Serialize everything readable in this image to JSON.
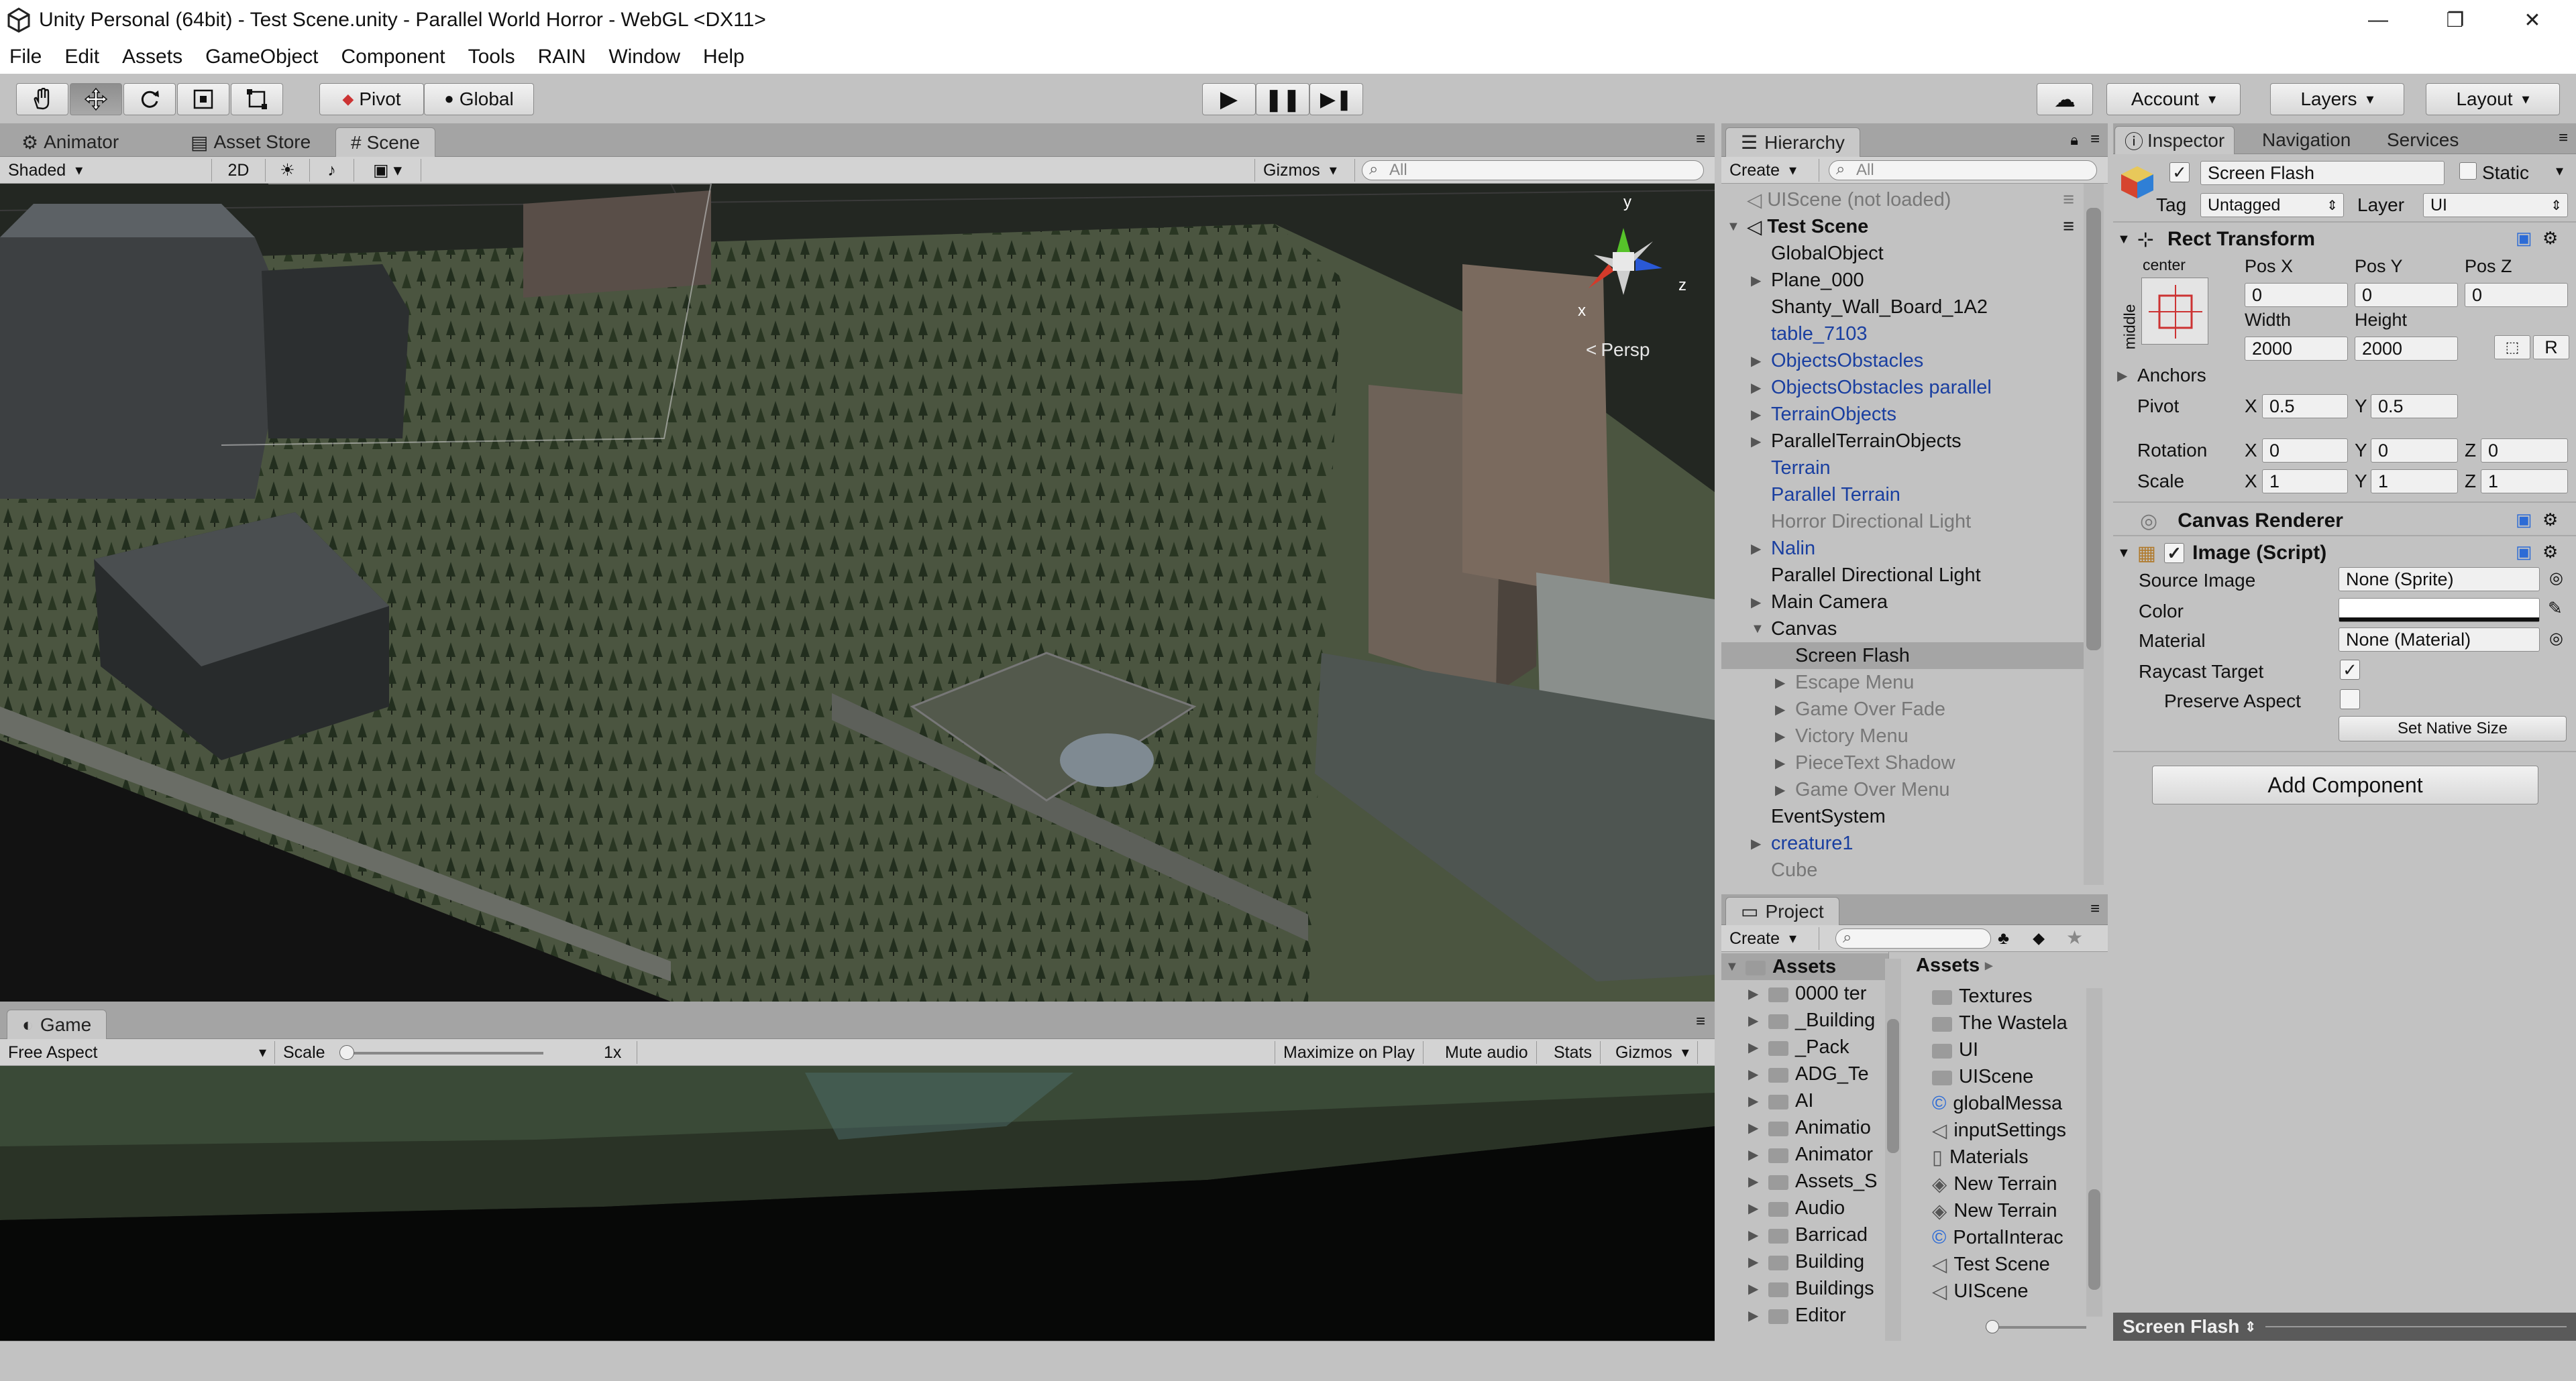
{
  "window": {
    "title": "Unity Personal (64bit) - Test Scene.unity - Parallel World Horror - WebGL <DX11>",
    "controls": [
      "—",
      "❐",
      "✕"
    ]
  },
  "menu": [
    "File",
    "Edit",
    "Assets",
    "GameObject",
    "Component",
    "Tools",
    "RAIN",
    "Window",
    "Help"
  ],
  "toolbar": {
    "pivot": "Pivot",
    "global": "Global",
    "account": "Account",
    "layers": "Layers",
    "layout": "Layout"
  },
  "scene_panel": {
    "tabs": [
      "Animator",
      "Asset Store",
      "Scene"
    ],
    "shading": "Shaded",
    "mode_2d": "2D",
    "gizmos": "Gizmos",
    "search_placeholder": "All",
    "persp": "Persp",
    "axis": {
      "x": "x",
      "y": "y",
      "z": "z"
    }
  },
  "game_panel": {
    "tab": "Game",
    "aspect": "Free Aspect",
    "scale_label": "Scale",
    "scale_value": "1x",
    "scale_fraction": 0.0,
    "buttons": [
      "Maximize on Play",
      "Mute audio",
      "Stats",
      "Gizmos"
    ]
  },
  "hierarchy": {
    "tab": "Hierarchy",
    "create": "Create",
    "search_placeholder": "All",
    "rows": [
      {
        "label": "UIScene (not loaded)",
        "indent": 0,
        "style": "gray",
        "arrow": "",
        "icon": true
      },
      {
        "label": "Test Scene",
        "indent": 0,
        "style": "bold",
        "arrow": "▼",
        "icon": true
      },
      {
        "label": "GlobalObject",
        "indent": 1,
        "style": "",
        "arrow": ""
      },
      {
        "label": "Plane_000",
        "indent": 1,
        "style": "",
        "arrow": "▶"
      },
      {
        "label": "Shanty_Wall_Board_1A2",
        "indent": 1,
        "style": "",
        "arrow": ""
      },
      {
        "label": "table_7103",
        "indent": 1,
        "style": "blue",
        "arrow": ""
      },
      {
        "label": "ObjectsObstacles",
        "indent": 1,
        "style": "blue",
        "arrow": "▶"
      },
      {
        "label": "ObjectsObstacles parallel",
        "indent": 1,
        "style": "blue",
        "arrow": "▶"
      },
      {
        "label": "TerrainObjects",
        "indent": 1,
        "style": "blue",
        "arrow": "▶"
      },
      {
        "label": "ParallelTerrainObjects",
        "indent": 1,
        "style": "",
        "arrow": "▶"
      },
      {
        "label": "Terrain",
        "indent": 1,
        "style": "blue",
        "arrow": ""
      },
      {
        "label": "Parallel Terrain",
        "indent": 1,
        "style": "blue",
        "arrow": ""
      },
      {
        "label": "Horror Directional Light",
        "indent": 1,
        "style": "gray",
        "arrow": ""
      },
      {
        "label": "Nalin",
        "indent": 1,
        "style": "blue",
        "arrow": "▶"
      },
      {
        "label": "Parallel Directional Light",
        "indent": 1,
        "style": "",
        "arrow": ""
      },
      {
        "label": "Main Camera",
        "indent": 1,
        "style": "",
        "arrow": "▶"
      },
      {
        "label": "Canvas",
        "indent": 1,
        "style": "",
        "arrow": "▼"
      },
      {
        "label": "Screen Flash",
        "indent": 2,
        "style": "sel",
        "arrow": ""
      },
      {
        "label": "Escape Menu",
        "indent": 2,
        "style": "gray",
        "arrow": "▶"
      },
      {
        "label": "Game Over Fade",
        "indent": 2,
        "style": "gray",
        "arrow": "▶"
      },
      {
        "label": "Victory Menu",
        "indent": 2,
        "style": "gray",
        "arrow": "▶"
      },
      {
        "label": "PieceText Shadow",
        "indent": 2,
        "style": "gray",
        "arrow": "▶"
      },
      {
        "label": "Game Over Menu",
        "indent": 2,
        "style": "gray",
        "arrow": "▶"
      },
      {
        "label": "EventSystem",
        "indent": 1,
        "style": "",
        "arrow": ""
      },
      {
        "label": "creature1",
        "indent": 1,
        "style": "blue",
        "arrow": "▶"
      },
      {
        "label": "Cube",
        "indent": 1,
        "style": "gray",
        "arrow": ""
      }
    ]
  },
  "project": {
    "tab": "Project",
    "create": "Create",
    "assets_label": "Assets",
    "tree": [
      "Assets",
      "0000 ter",
      "_Building",
      "_Pack",
      "ADG_Te",
      "AI",
      "Animatio",
      "Animator",
      "Assets_S",
      "Audio",
      "Barricad",
      "Building",
      "Buildings",
      "Editor"
    ],
    "files": [
      "Textures",
      "The Wastela",
      "UI",
      "UIScene",
      "globalMessa",
      "inputSettings",
      "Materials",
      "New Terrain",
      "New Terrain",
      "PortalInterac",
      "Test Scene",
      "UIScene"
    ]
  },
  "inspector": {
    "tabs": [
      "Inspector",
      "Navigation",
      "Services"
    ],
    "object_name": "Screen Flash",
    "static_label": "Static",
    "tag_label": "Tag",
    "tag_value": "Untagged",
    "layer_label": "Layer",
    "layer_value": "UI",
    "rect_transform": {
      "title": "Rect Transform",
      "anchor_h": "center",
      "anchor_v": "middle",
      "pos_x_label": "Pos X",
      "pos_y_label": "Pos Y",
      "pos_z_label": "Pos Z",
      "pos_x": "0",
      "pos_y": "0",
      "pos_z": "0",
      "width_label": "Width",
      "height_label": "Height",
      "width": "2000",
      "height": "2000",
      "r_button": "R",
      "anchors_label": "Anchors",
      "pivot_label": "Pivot",
      "pivot_x": "0.5",
      "pivot_y": "0.5",
      "rotation_label": "Rotation",
      "rot_x": "0",
      "rot_y": "0",
      "rot_z": "0",
      "scale_label": "Scale",
      "scale_x": "1",
      "scale_y": "1",
      "scale_z": "1",
      "x": "X",
      "y": "Y",
      "z": "Z"
    },
    "canvas_renderer": "Canvas Renderer",
    "image_script": {
      "title": "Image (Script)",
      "source_image_label": "Source Image",
      "source_image": "None (Sprite)",
      "color_label": "Color",
      "material_label": "Material",
      "material": "None (Material)",
      "raycast_label": "Raycast Target",
      "preserve_label": "Preserve Aspect",
      "set_native": "Set Native Size"
    },
    "add_component": "Add Component",
    "preview_title": "Screen Flash"
  },
  "colors": {
    "accent_blue": "#1a3fa0",
    "selection": "#a5a5a5",
    "panel": "#c2c2c2"
  }
}
